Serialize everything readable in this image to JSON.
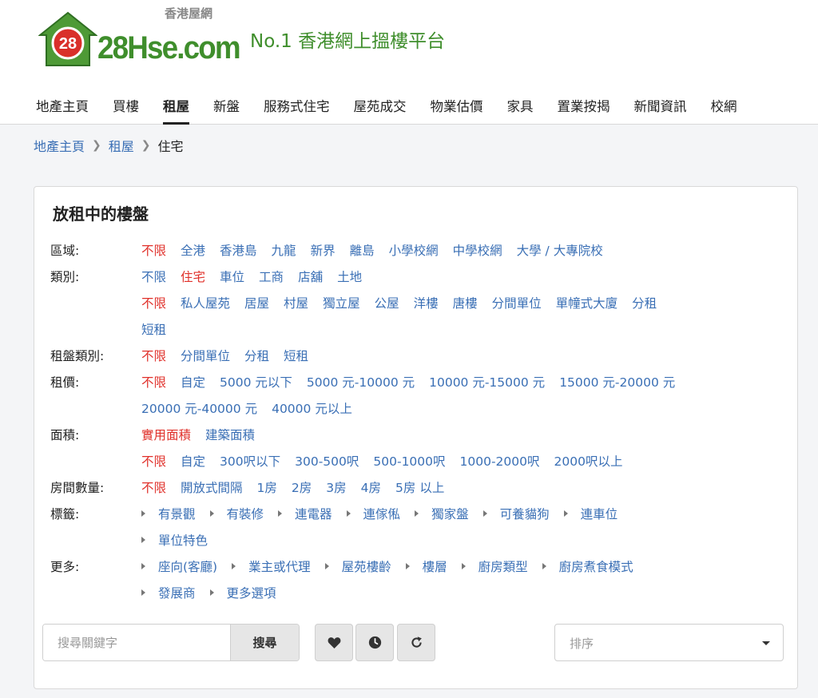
{
  "header": {
    "logo_sub": "香港屋網",
    "logo_number": "28",
    "logo_text": "28Hse.com",
    "tagline": "No.1 香港網上搵樓平台",
    "nav": [
      {
        "label": "地產主頁",
        "active": false
      },
      {
        "label": "買樓",
        "active": false
      },
      {
        "label": "租屋",
        "active": true
      },
      {
        "label": "新盤",
        "active": false
      },
      {
        "label": "服務式住宅",
        "active": false
      },
      {
        "label": "屋苑成交",
        "active": false
      },
      {
        "label": "物業估價",
        "active": false
      },
      {
        "label": "家具",
        "active": false
      },
      {
        "label": "置業按揭",
        "active": false
      },
      {
        "label": "新聞資訊",
        "active": false
      },
      {
        "label": "校網",
        "active": false
      }
    ]
  },
  "breadcrumb": {
    "home": "地產主頁",
    "section": "租屋",
    "current": "住宅"
  },
  "panel": {
    "title": "放租中的樓盤",
    "labels": {
      "region": "區域:",
      "category": "類別:",
      "rent_type": "租盤類別:",
      "price": "租價:",
      "area": "面積:",
      "rooms": "房間數量:",
      "tags": "標籤:",
      "more": "更多:"
    },
    "region": [
      "不限",
      "全港",
      "香港島",
      "九龍",
      "新界",
      "離島",
      "小學校網",
      "中學校網",
      "大學 / 大專院校"
    ],
    "category_1": [
      "不限",
      "住宅",
      "車位",
      "工商",
      "店舖",
      "土地"
    ],
    "category_2": [
      "不限",
      "私人屋苑",
      "居屋",
      "村屋",
      "獨立屋",
      "公屋",
      "洋樓",
      "唐樓",
      "分間單位",
      "單幢式大廈",
      "分租"
    ],
    "category_3": [
      "短租"
    ],
    "rent_type": [
      "不限",
      "分間單位",
      "分租",
      "短租"
    ],
    "price_1": [
      "不限",
      "自定",
      "5000 元以下",
      "5000 元-10000 元",
      "10000 元-15000 元",
      "15000 元-20000 元"
    ],
    "price_2": [
      "20000 元-40000 元",
      "40000 元以上"
    ],
    "area_1": [
      "實用面積",
      "建築面積"
    ],
    "area_2": [
      "不限",
      "自定",
      "300呎以下",
      "300-500呎",
      "500-1000呎",
      "1000-2000呎",
      "2000呎以上"
    ],
    "rooms": [
      "不限",
      "開放式間隔",
      "1房",
      "2房",
      "3房",
      "4房",
      "5房 以上"
    ],
    "tags_1": [
      "有景觀",
      "有裝修",
      "連電器",
      "連傢俬",
      "獨家盤",
      "可養貓狗",
      "連車位"
    ],
    "tags_2": [
      "單位特色"
    ],
    "more_1": [
      "座向(客廳)",
      "業主或代理",
      "屋苑樓齡",
      "樓層",
      "廚房類型",
      "廚房煮食模式"
    ],
    "more_2": [
      "發展商",
      "更多選項"
    ]
  },
  "search": {
    "placeholder": "搜尋關鍵字",
    "button": "搜尋"
  },
  "sort": {
    "placeholder": "排序"
  },
  "icons": [
    "heart-icon",
    "clock-icon",
    "refresh-icon"
  ],
  "colors": {
    "brand_green": "#3f8e2c",
    "link_blue": "#3a6fb5",
    "selected_red": "#e0302a"
  }
}
